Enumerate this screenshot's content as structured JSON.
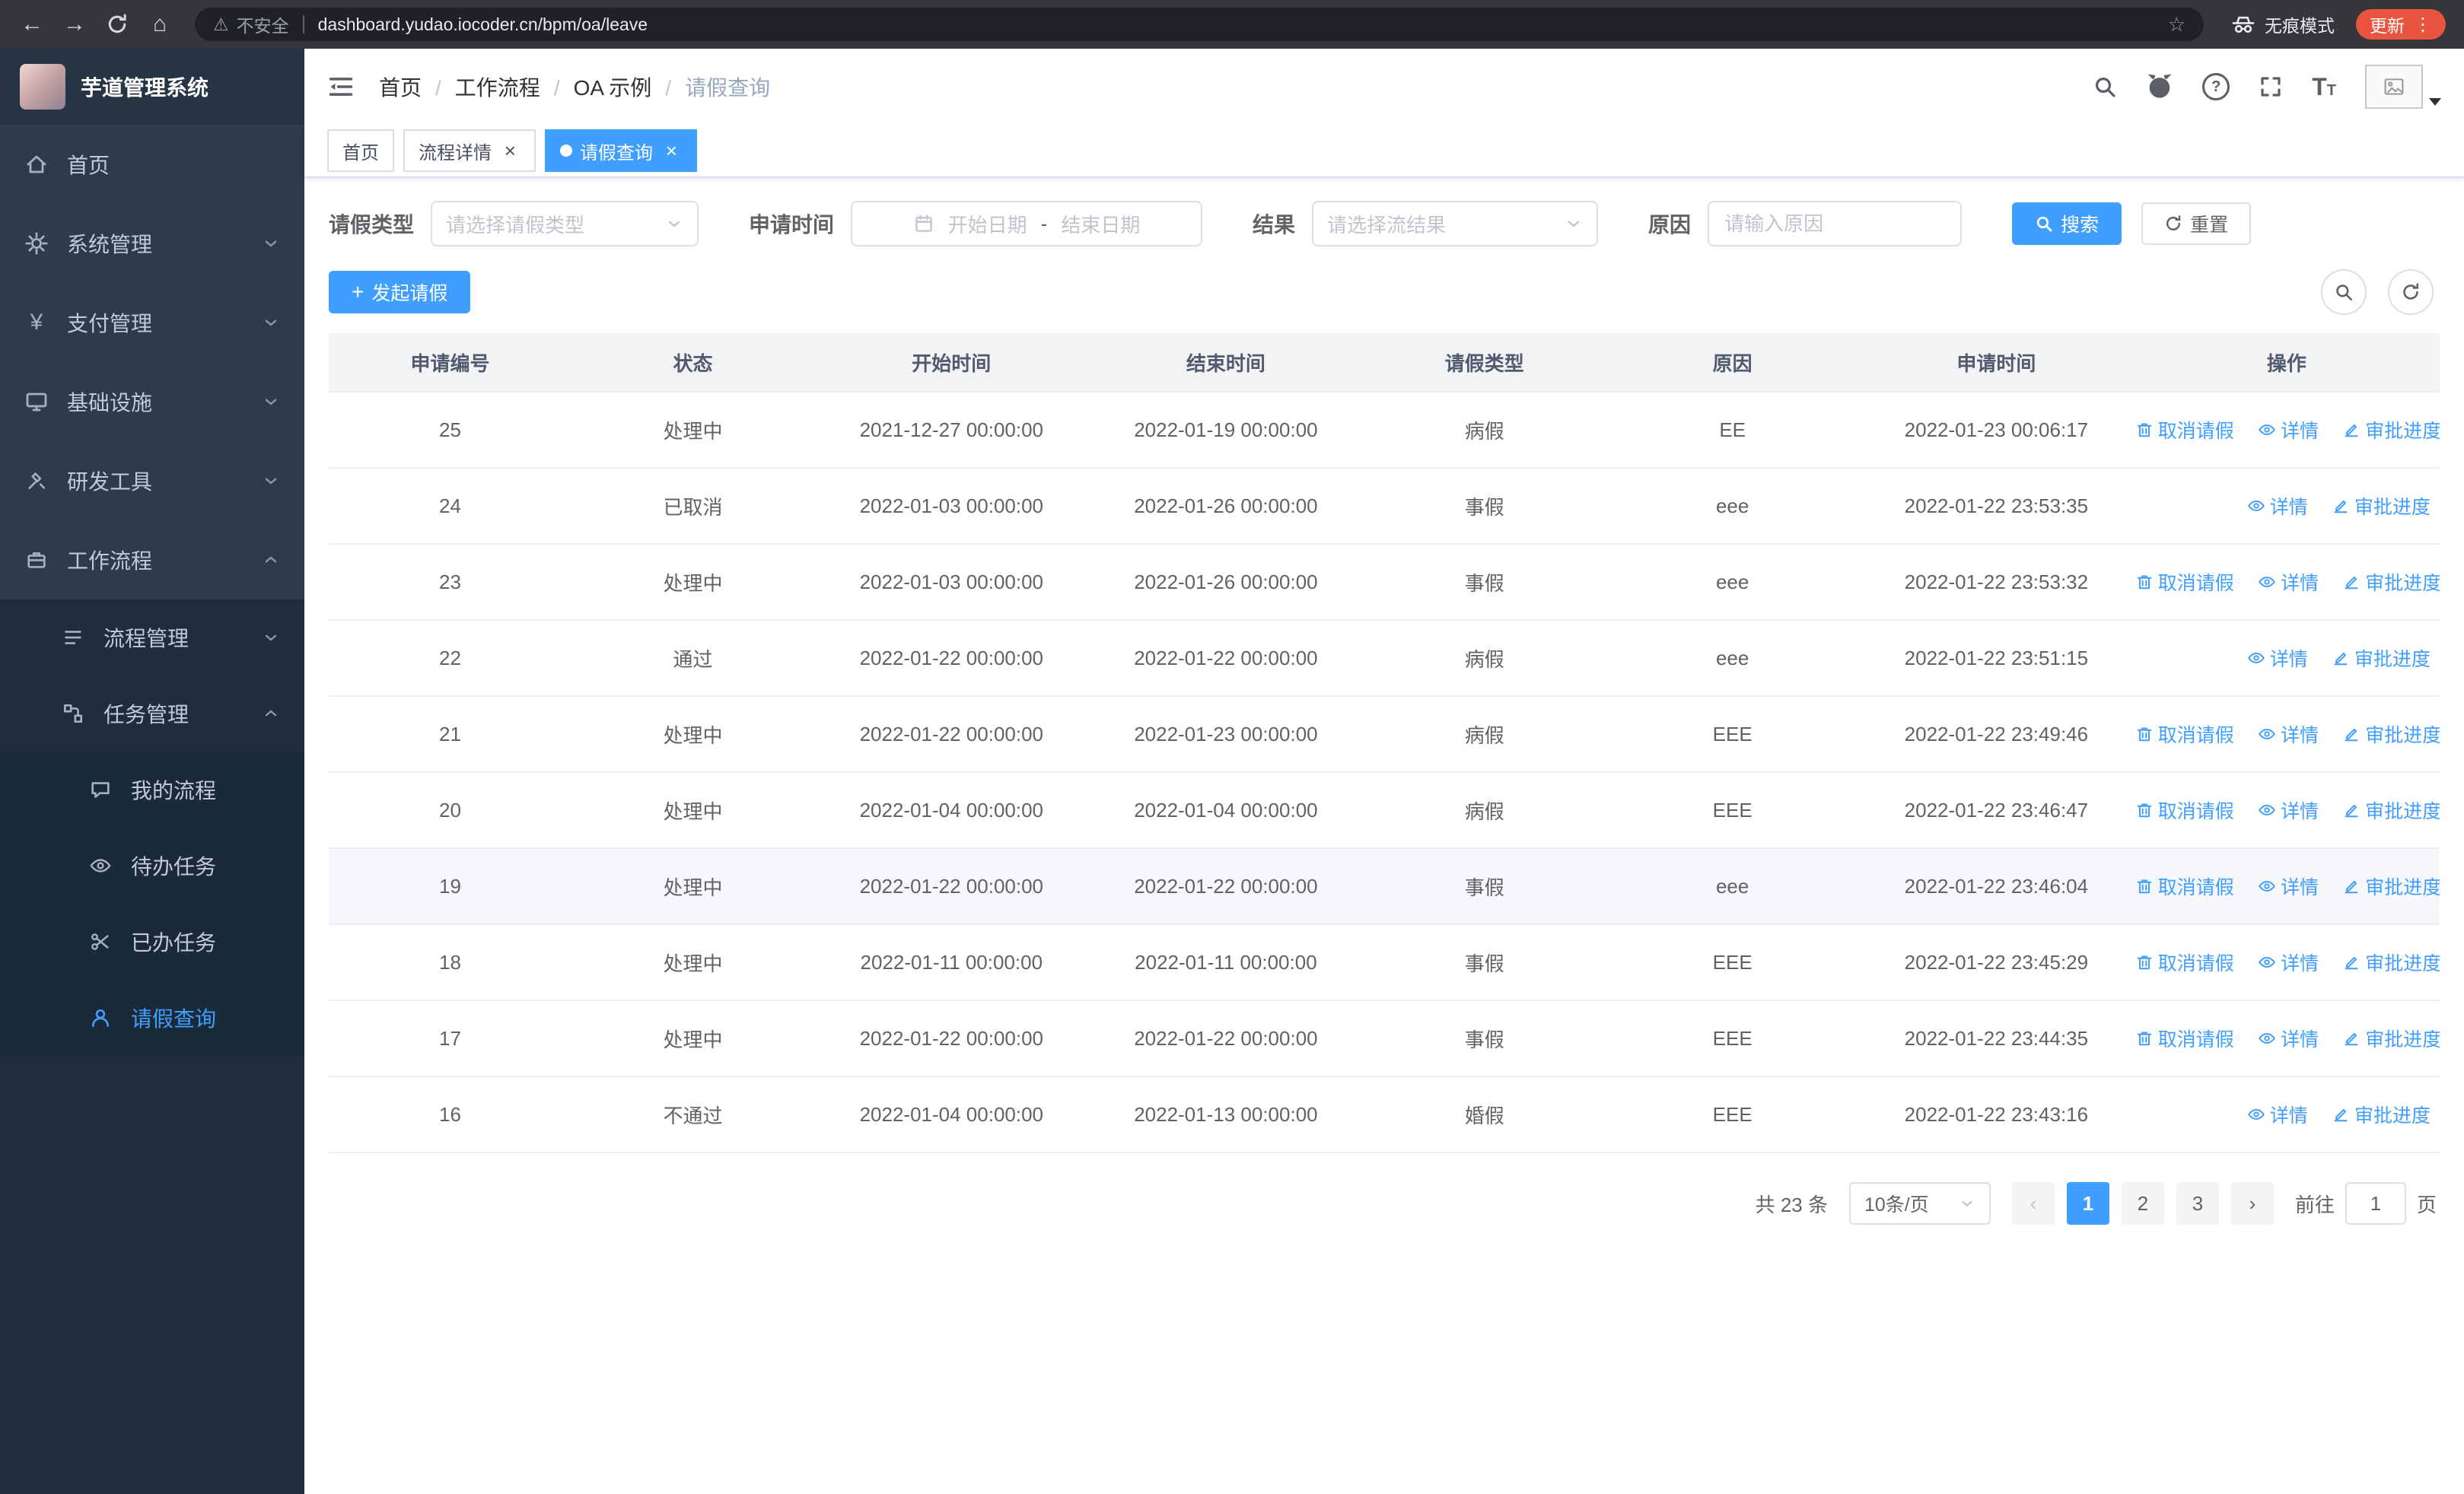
{
  "browser": {
    "security_label": "不安全",
    "url": "dashboard.yudao.iocoder.cn/bpm/oa/leave",
    "incognito_label": "无痕模式",
    "update_label": "更新"
  },
  "app": {
    "title": "芋道管理系统"
  },
  "colors": {
    "accent": "#409eff",
    "sidebar_bg": "#1f2d3d",
    "danger": "#e8543f"
  },
  "icons": {
    "back": "←",
    "forward": "→",
    "home": "⌂",
    "warning": "⚠",
    "star": "☆",
    "dots": "⋮",
    "close": "×",
    "prev": "‹",
    "next": "›",
    "plus": "+",
    "yen": "¥",
    "question": "?",
    "t_glyph": "T"
  },
  "sidebar": {
    "items": [
      {
        "label": "首页"
      },
      {
        "label": "系统管理",
        "chevron": "down"
      },
      {
        "label": "支付管理",
        "chevron": "down"
      },
      {
        "label": "基础设施",
        "chevron": "down"
      },
      {
        "label": "研发工具",
        "chevron": "down"
      },
      {
        "label": "工作流程",
        "chevron": "up",
        "expanded": true
      }
    ],
    "workflow_children": [
      {
        "label": "流程管理",
        "chevron": "down"
      },
      {
        "label": "任务管理",
        "chevron": "up",
        "expanded": true
      }
    ],
    "task_children": [
      {
        "label": "我的流程"
      },
      {
        "label": "待办任务"
      },
      {
        "label": "已办任务"
      },
      {
        "label": "请假查询",
        "active": true
      }
    ]
  },
  "breadcrumb": [
    "首页",
    "工作流程",
    "OA 示例",
    "请假查询"
  ],
  "tabs": [
    {
      "label": "首页",
      "active": false,
      "closable": false
    },
    {
      "label": "流程详情",
      "active": false,
      "closable": true
    },
    {
      "label": "请假查询",
      "active": true,
      "closable": true
    }
  ],
  "filters": {
    "leave_type": {
      "label": "请假类型",
      "placeholder": "请选择请假类型"
    },
    "apply_time": {
      "label": "申请时间",
      "start_placeholder": "开始日期",
      "separator": "-",
      "end_placeholder": "结束日期"
    },
    "result": {
      "label": "结果",
      "placeholder": "请选择流结果"
    },
    "reason": {
      "label": "原因",
      "placeholder": "请输入原因"
    },
    "search_label": "搜索",
    "reset_label": "重置"
  },
  "toolbar": {
    "create_label": "发起请假"
  },
  "table": {
    "columns": [
      "申请编号",
      "状态",
      "开始时间",
      "结束时间",
      "请假类型",
      "原因",
      "申请时间",
      "操作"
    ],
    "action_cancel": "取消请假",
    "action_detail": "详情",
    "action_progress": "审批进度",
    "rows": [
      {
        "id": "25",
        "status": "处理中",
        "start": "2021-12-27 00:00:00",
        "end": "2022-01-19 00:00:00",
        "type": "病假",
        "reason": "EE",
        "apply_time": "2022-01-23 00:06:17",
        "can_cancel": true,
        "highlighted": false
      },
      {
        "id": "24",
        "status": "已取消",
        "start": "2022-01-03 00:00:00",
        "end": "2022-01-26 00:00:00",
        "type": "事假",
        "reason": "eee",
        "apply_time": "2022-01-22 23:53:35",
        "can_cancel": false,
        "highlighted": false
      },
      {
        "id": "23",
        "status": "处理中",
        "start": "2022-01-03 00:00:00",
        "end": "2022-01-26 00:00:00",
        "type": "事假",
        "reason": "eee",
        "apply_time": "2022-01-22 23:53:32",
        "can_cancel": true,
        "highlighted": false
      },
      {
        "id": "22",
        "status": "通过",
        "start": "2022-01-22 00:00:00",
        "end": "2022-01-22 00:00:00",
        "type": "病假",
        "reason": "eee",
        "apply_time": "2022-01-22 23:51:15",
        "can_cancel": false,
        "highlighted": false
      },
      {
        "id": "21",
        "status": "处理中",
        "start": "2022-01-22 00:00:00",
        "end": "2022-01-23 00:00:00",
        "type": "病假",
        "reason": "EEE",
        "apply_time": "2022-01-22 23:49:46",
        "can_cancel": true,
        "highlighted": false
      },
      {
        "id": "20",
        "status": "处理中",
        "start": "2022-01-04 00:00:00",
        "end": "2022-01-04 00:00:00",
        "type": "病假",
        "reason": "EEE",
        "apply_time": "2022-01-22 23:46:47",
        "can_cancel": true,
        "highlighted": false
      },
      {
        "id": "19",
        "status": "处理中",
        "start": "2022-01-22 00:00:00",
        "end": "2022-01-22 00:00:00",
        "type": "事假",
        "reason": "eee",
        "apply_time": "2022-01-22 23:46:04",
        "can_cancel": true,
        "highlighted": true
      },
      {
        "id": "18",
        "status": "处理中",
        "start": "2022-01-11 00:00:00",
        "end": "2022-01-11 00:00:00",
        "type": "事假",
        "reason": "EEE",
        "apply_time": "2022-01-22 23:45:29",
        "can_cancel": true,
        "highlighted": false
      },
      {
        "id": "17",
        "status": "处理中",
        "start": "2022-01-22 00:00:00",
        "end": "2022-01-22 00:00:00",
        "type": "事假",
        "reason": "EEE",
        "apply_time": "2022-01-22 23:44:35",
        "can_cancel": true,
        "highlighted": false
      },
      {
        "id": "16",
        "status": "不通过",
        "start": "2022-01-04 00:00:00",
        "end": "2022-01-13 00:00:00",
        "type": "婚假",
        "reason": "EEE",
        "apply_time": "2022-01-22 23:43:16",
        "can_cancel": false,
        "highlighted": false
      }
    ]
  },
  "pagination": {
    "total": "共 23 条",
    "page_size": "10条/页",
    "pages": [
      {
        "label": "1",
        "active": true
      },
      {
        "label": "2",
        "active": false
      },
      {
        "label": "3",
        "active": false
      }
    ],
    "goto_label": "前往",
    "goto_value": "1",
    "goto_unit": "页"
  }
}
